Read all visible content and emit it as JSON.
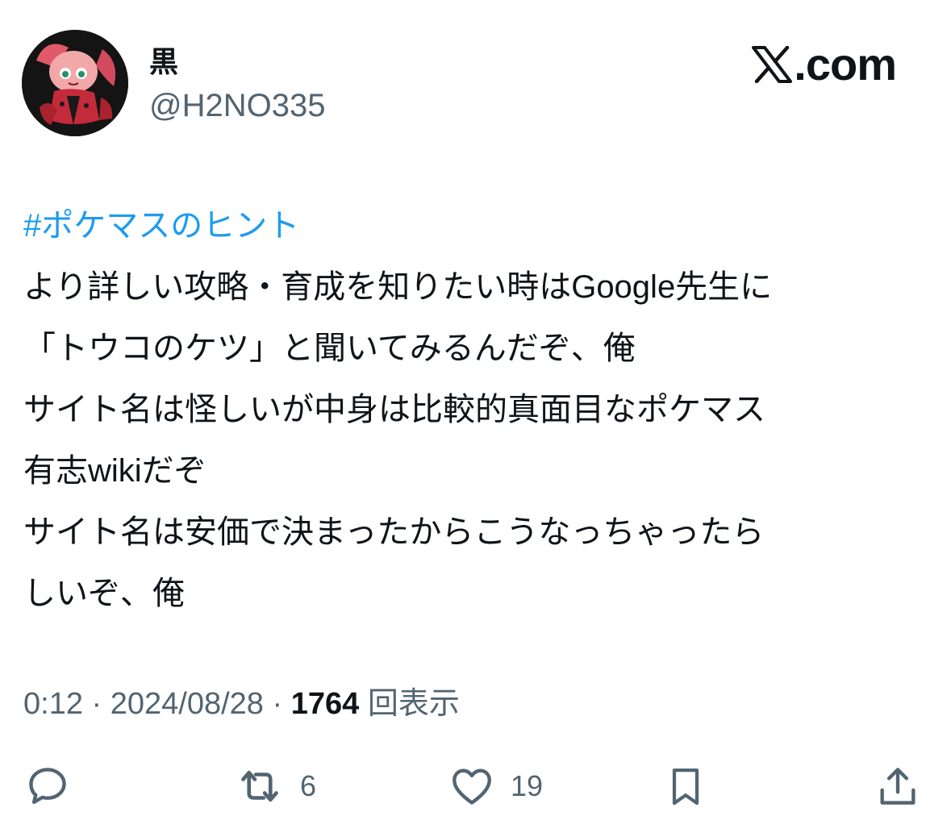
{
  "author": {
    "display_name": "黒",
    "handle": "@H2NO335",
    "avatar_icon": "character-avatar-icon"
  },
  "brand": {
    "label": ".com",
    "icon": "x-logo-icon"
  },
  "tweet": {
    "hashtag": "#ポケマスのヒント",
    "lines": [
      "より詳しい攻略・育成を知りたい時はGoogle先生に",
      "「トウコのケツ」と聞いてみるんだぞ、俺",
      "サイト名は怪しいが中身は比較的真面目なポケマス",
      "有志wikiだぞ",
      "サイト名は安価で決まったからこうなっちゃったら",
      "しいぞ、俺"
    ]
  },
  "meta": {
    "time": "0:12",
    "separator": " · ",
    "date": "2024/08/28",
    "views_count": "1764",
    "views_label": "回表示"
  },
  "actions": {
    "reply": {
      "icon": "reply-icon",
      "count": ""
    },
    "retweet": {
      "icon": "retweet-icon",
      "count": "6"
    },
    "like": {
      "icon": "heart-icon",
      "count": "19"
    },
    "bookmark": {
      "icon": "bookmark-icon"
    },
    "share": {
      "icon": "share-icon"
    }
  },
  "colors": {
    "text": "#0f1419",
    "secondary": "#536471",
    "link": "#1d9bf0",
    "background": "#ffffff"
  }
}
